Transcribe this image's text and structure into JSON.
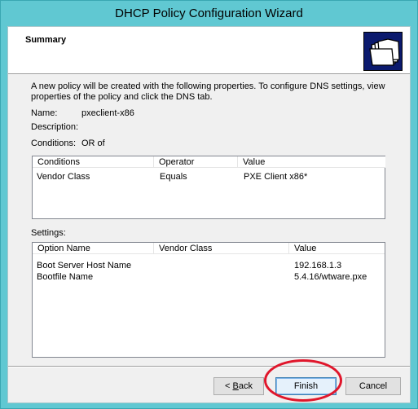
{
  "window": {
    "title": "DHCP Policy Configuration Wizard"
  },
  "header": {
    "heading": "Summary",
    "icon": "folder-stack-icon"
  },
  "intro": "A new policy will be created with the following properties. To configure DNS settings, view properties of the policy and click the DNS tab.",
  "name": {
    "label": "Name:",
    "value": "pxeclient-x86"
  },
  "description": {
    "label": "Description:",
    "value": ""
  },
  "conditions_summary": {
    "label": "Conditions:",
    "value": "OR of"
  },
  "conditions_table": {
    "columns": [
      "Conditions",
      "Operator",
      "Value"
    ],
    "rows": [
      [
        "Vendor Class",
        "Equals",
        "PXE Client x86*"
      ]
    ]
  },
  "settings": {
    "label": "Settings:",
    "columns": [
      "Option Name",
      "Vendor Class",
      "Value"
    ],
    "rows": [
      [
        "Boot Server Host Name",
        "",
        "192.168.1.3"
      ],
      [
        "Bootfile Name",
        "",
        "5.4.16/wtware.pxe"
      ]
    ]
  },
  "buttons": {
    "back": {
      "prefix": "< ",
      "accel": "B",
      "rest": "ack"
    },
    "finish": "Finish",
    "cancel": "Cancel"
  },
  "annotation": {
    "highlight_color": "#e0162b"
  }
}
